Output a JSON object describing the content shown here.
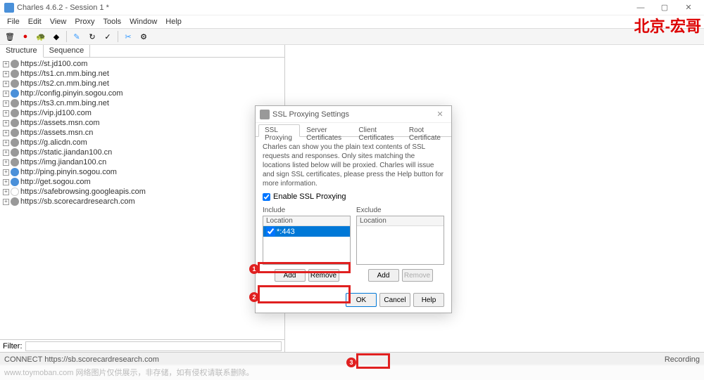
{
  "title": "Charles 4.6.2 - Session 1 *",
  "watermark": "北京-宏哥",
  "menu": [
    "File",
    "Edit",
    "View",
    "Proxy",
    "Tools",
    "Window",
    "Help"
  ],
  "tabs": {
    "structure": "Structure",
    "sequence": "Sequence"
  },
  "tree": [
    {
      "icon": "lock",
      "label": "https://st.jd100.com"
    },
    {
      "icon": "lock",
      "label": "https://ts1.cn.mm.bing.net"
    },
    {
      "icon": "lock",
      "label": "https://ts2.cn.mm.bing.net"
    },
    {
      "icon": "blue",
      "label": "http://config.pinyin.sogou.com"
    },
    {
      "icon": "lock",
      "label": "https://ts3.cn.mm.bing.net"
    },
    {
      "icon": "lock",
      "label": "https://vip.jd100.com"
    },
    {
      "icon": "lock",
      "label": "https://assets.msn.com"
    },
    {
      "icon": "lock",
      "label": "https://assets.msn.cn"
    },
    {
      "icon": "lock",
      "label": "https://g.alicdn.com"
    },
    {
      "icon": "lock",
      "label": "https://static.jiandan100.cn"
    },
    {
      "icon": "lock",
      "label": "https://img.jiandan100.cn"
    },
    {
      "icon": "blue",
      "label": "http://ping.pinyin.sogou.com"
    },
    {
      "icon": "blue",
      "label": "http://get.sogou.com"
    },
    {
      "icon": "unknown",
      "label": "https://safebrowsing.googleapis.com"
    },
    {
      "icon": "lock",
      "label": "https://sb.scorecardresearch.com"
    }
  ],
  "filter_label": "Filter:",
  "statusbar_left": "CONNECT https://sb.scorecardresearch.com",
  "statusbar_right": "Recording",
  "footer_overlay": "www.toymoban.com 网络图片仅供展示，非存储，如有侵权请联系删除。",
  "dialog": {
    "title": "SSL Proxying Settings",
    "tabs": [
      "SSL Proxying",
      "Server Certificates",
      "Client Certificates",
      "Root Certificate"
    ],
    "help": "Charles can show you the plain text contents of SSL requests and responses. Only sites matching the locations listed below will be proxied. Charles will issue and sign SSL certificates, please press the Help button for more information.",
    "enable_label": "Enable SSL Proxying",
    "include_label": "Include",
    "exclude_label": "Exclude",
    "col_header": "Location",
    "include_item": "*:443",
    "add_btn": "Add",
    "remove_btn": "Remove",
    "ok": "OK",
    "cancel": "Cancel",
    "help_btn": "Help"
  }
}
